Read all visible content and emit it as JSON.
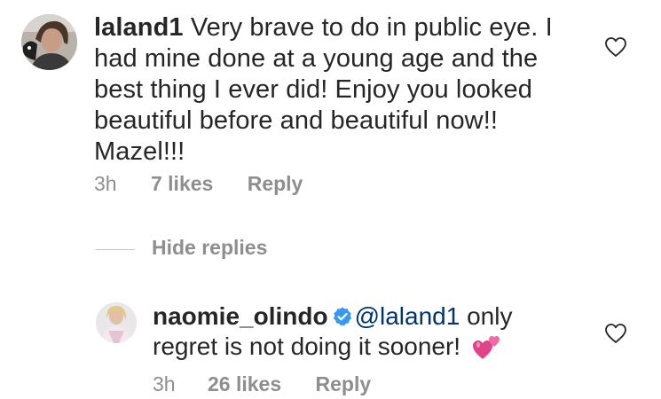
{
  "comments": [
    {
      "username": "laland1",
      "text": "Very brave to do in public eye. I had mine done at a young age and the best thing I ever did! Enjoy you looked beautiful before and beautiful now!! Mazel!!!",
      "time": "3h",
      "likes": "7 likes",
      "reply_label": "Reply"
    }
  ],
  "thread": {
    "toggle_label": "Hide replies"
  },
  "reply": {
    "username": "naomie_olindo",
    "mention": "@laland1",
    "text_after_mention": " only regret is not doing it sooner!",
    "emoji": "💕",
    "time": "3h",
    "likes": "26 likes",
    "reply_label": "Reply",
    "verified": true
  },
  "colors": {
    "text": "#262626",
    "secondary": "#8e8e8e",
    "mention": "#003569",
    "verified_badge": "#3897f0",
    "emoji": "#e0458a"
  },
  "icons": [
    "avatar",
    "verified-badge-icon",
    "heart-icon"
  ]
}
